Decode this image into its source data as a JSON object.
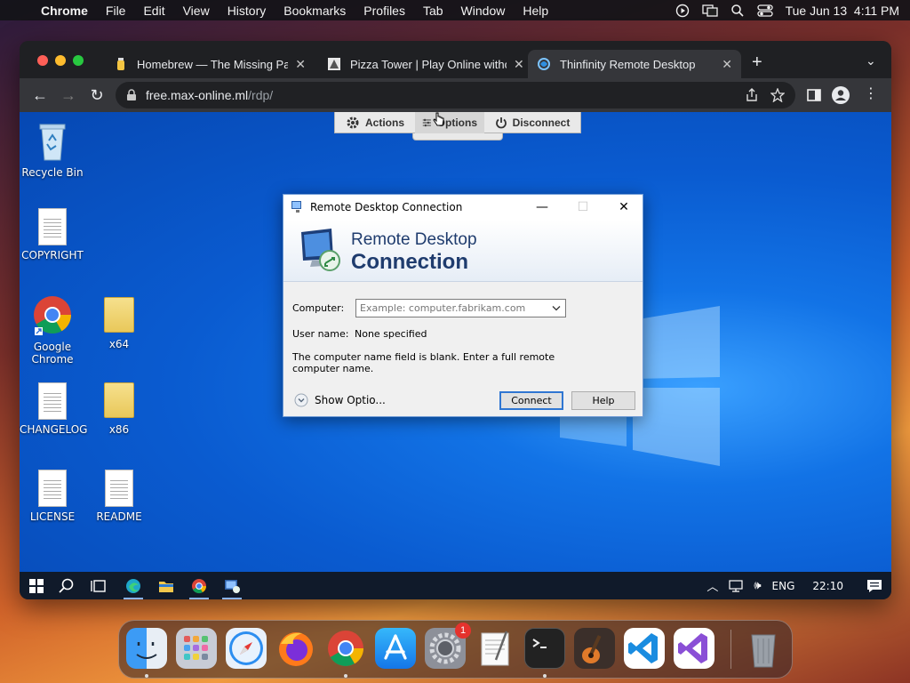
{
  "menubar": {
    "app_name": "Chrome",
    "items": [
      "File",
      "Edit",
      "View",
      "History",
      "Bookmarks",
      "Profiles",
      "Tab",
      "Window",
      "Help"
    ],
    "datetime": "Tue Jun 13  4:11 PM"
  },
  "browser": {
    "tabs": [
      {
        "title": "Homebrew — The Missing Pack",
        "active": false
      },
      {
        "title": "Pizza Tower | Play Online witho",
        "active": false
      },
      {
        "title": "Thinfinity Remote Desktop",
        "active": true
      }
    ],
    "url_host": "free.max-online.ml",
    "url_path": "/rdp/"
  },
  "rdp_toolbar": {
    "actions": "Actions",
    "options": "Options",
    "disconnect": "Disconnect"
  },
  "desktop_icons": [
    {
      "label": "Recycle Bin"
    },
    {
      "label": "COPYRIGHT"
    },
    {
      "label": "Google Chrome"
    },
    {
      "label": "x64"
    },
    {
      "label": "CHANGELOG"
    },
    {
      "label": "x86"
    },
    {
      "label": "LICENSE"
    },
    {
      "label": "README"
    }
  ],
  "dialog": {
    "title": "Remote Desktop Connection",
    "banner_line1": "Remote Desktop",
    "banner_line2": "Connection",
    "computer_label": "Computer:",
    "computer_placeholder": "Example: computer.fabrikam.com",
    "username_label": "User name:",
    "username_value": "None specified",
    "message": "The computer name field is blank. Enter a full remote computer name.",
    "show_options": "Show Optio...",
    "connect": "Connect",
    "help": "Help"
  },
  "taskbar": {
    "lang": "ENG",
    "time": "22:10"
  },
  "dock": {
    "apps": [
      "Finder",
      "Launchpad",
      "Safari",
      "Firefox",
      "Chrome",
      "App Store",
      "System Settings",
      "TextEdit",
      "Terminal",
      "GarageBand",
      "VS Code",
      "Visual Studio",
      "Trash"
    ],
    "settings_badge": "1"
  }
}
